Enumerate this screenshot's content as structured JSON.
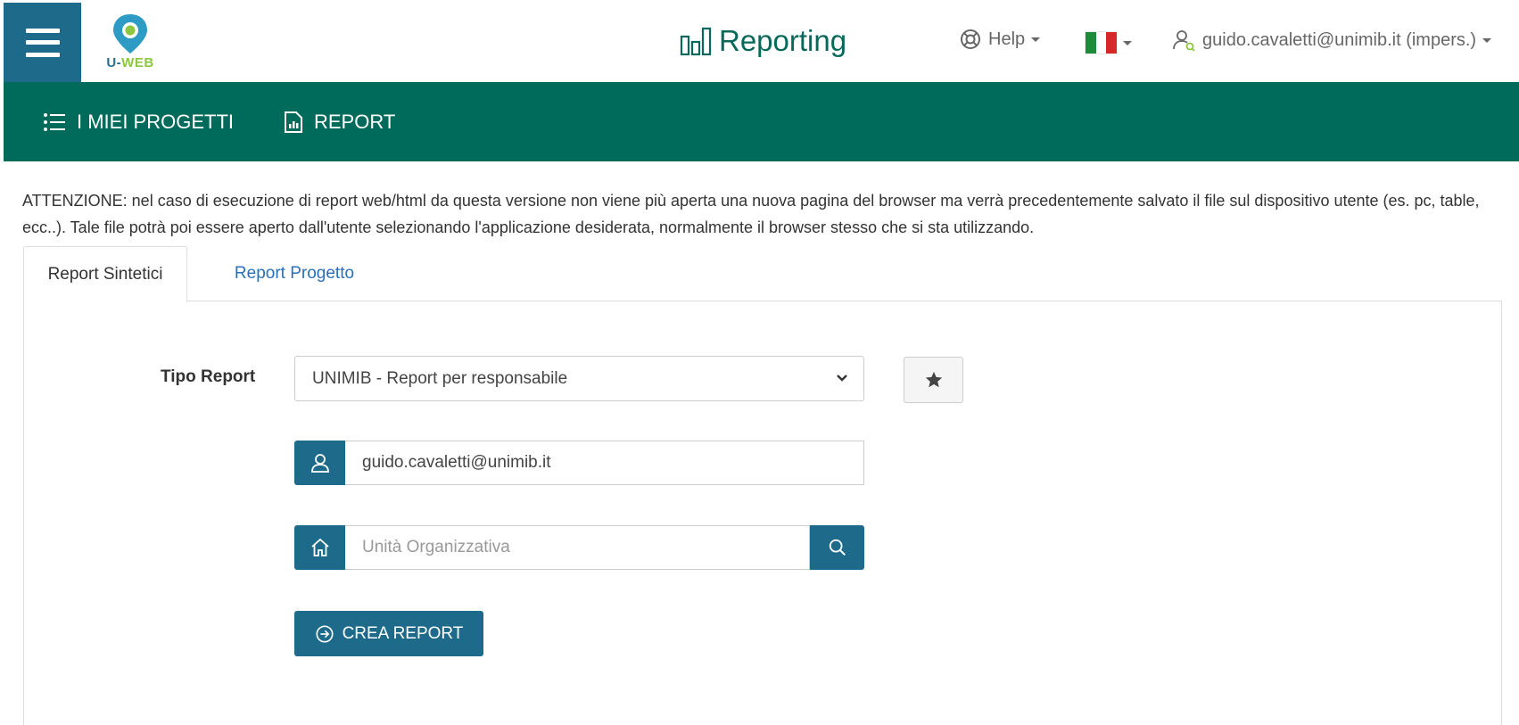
{
  "header": {
    "logo_text_u": "U-",
    "logo_text_web": "WEB",
    "app_title": "Reporting",
    "help_label": "Help",
    "user_label": "guido.cavaletti@unimib.it (impers.)"
  },
  "nav": {
    "items": [
      {
        "label": "I MIEI PROGETTI",
        "icon": "list-icon"
      },
      {
        "label": "REPORT",
        "icon": "report-icon"
      }
    ]
  },
  "notice": "ATTENZIONE: nel caso di esecuzione di report web/html da questa versione non viene più aperta una nuova pagina del browser ma verrà precedentemente salvato il file sul dispositivo utente (es. pc, table, ecc..). Tale file potrà poi essere aperto dall'utente selezionando l'applicazione desiderata, normalmente il browser stesso che si sta utilizzando.",
  "tabs": [
    {
      "label": "Report Sintetici",
      "active": true
    },
    {
      "label": "Report Progetto",
      "active": false
    }
  ],
  "form": {
    "tipo_report_label": "Tipo Report",
    "tipo_report_value": "UNIMIB - Report per responsabile",
    "user_value": "guido.cavaletti@unimib.it",
    "unita_placeholder": "Unità Organizzativa",
    "crea_label": "CREA REPORT"
  },
  "colors": {
    "primary": "#1e6a8a",
    "nav_green": "#006b5b",
    "title_green": "#08685a",
    "link": "#2a70b8"
  }
}
